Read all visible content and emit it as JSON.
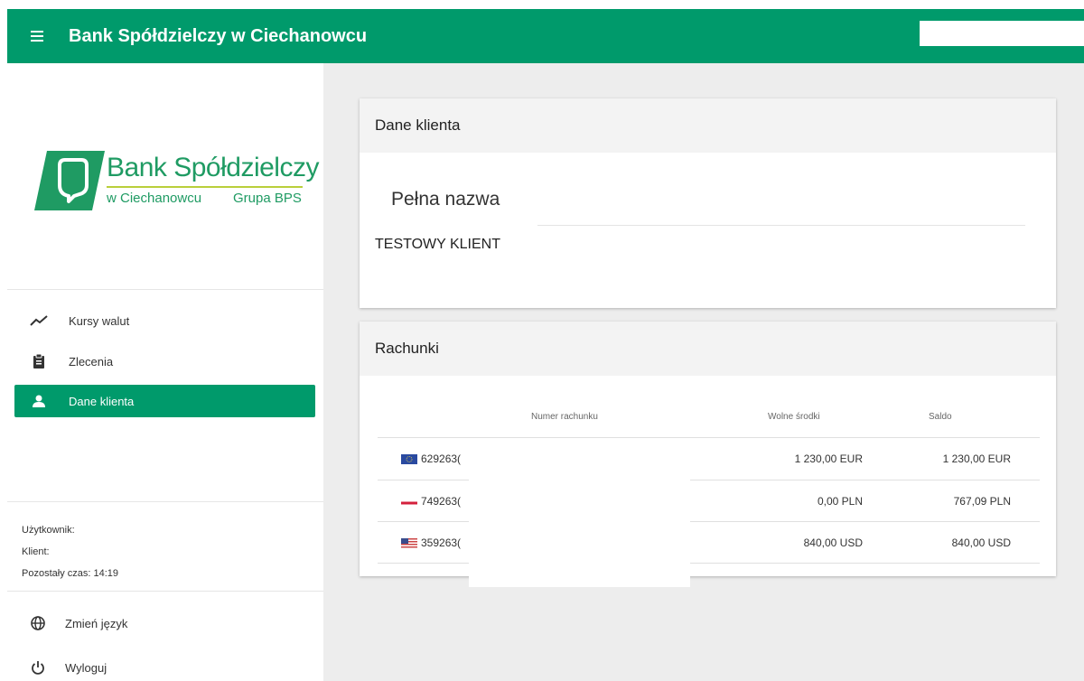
{
  "header": {
    "title": "Bank Spółdzielczy w Ciechanowcu",
    "search_value": ""
  },
  "logo": {
    "main": "Bank Spółdzielczy",
    "sub_left": "w Ciechanowcu",
    "sub_right": "Grupa BPS",
    "colors": {
      "primary": "#1f9b63",
      "accent": "#b9cf3b"
    }
  },
  "sidebar": {
    "items": [
      {
        "label": "Kursy walut",
        "icon": "trending-up-icon",
        "active": false
      },
      {
        "label": "Zlecenia",
        "icon": "clipboard-icon",
        "active": false
      },
      {
        "label": "Dane klienta",
        "icon": "person-icon",
        "active": true
      }
    ],
    "session": {
      "user_label": "Użytkownik:",
      "client_label": "Klient:",
      "remaining_label": "Pozostały czas: 14:19"
    },
    "bottom": [
      {
        "label": "Zmień język",
        "icon": "globe-icon"
      },
      {
        "label": "Wyloguj",
        "icon": "power-icon"
      }
    ]
  },
  "client_card": {
    "title": "Dane klienta",
    "field_label": "Pełna nazwa",
    "field_value": "TESTOWY KLIENT"
  },
  "accounts_card": {
    "title": "Rachunki",
    "columns": [
      "Numer rachunku",
      "Wolne środki",
      "Saldo"
    ],
    "rows": [
      {
        "flag": "eu-flag-icon",
        "number": "629263(",
        "available": "1 230,00 EUR",
        "balance": "1 230,00 EUR"
      },
      {
        "flag": "pl-flag-icon",
        "number": "749263(",
        "available": "0,00 PLN",
        "balance": "767,09 PLN"
      },
      {
        "flag": "us-flag-icon",
        "number": "359263(",
        "available": "840,00 USD",
        "balance": "840,00 USD"
      }
    ]
  },
  "colors": {
    "brand": "#009a6b",
    "background": "#ededed"
  }
}
